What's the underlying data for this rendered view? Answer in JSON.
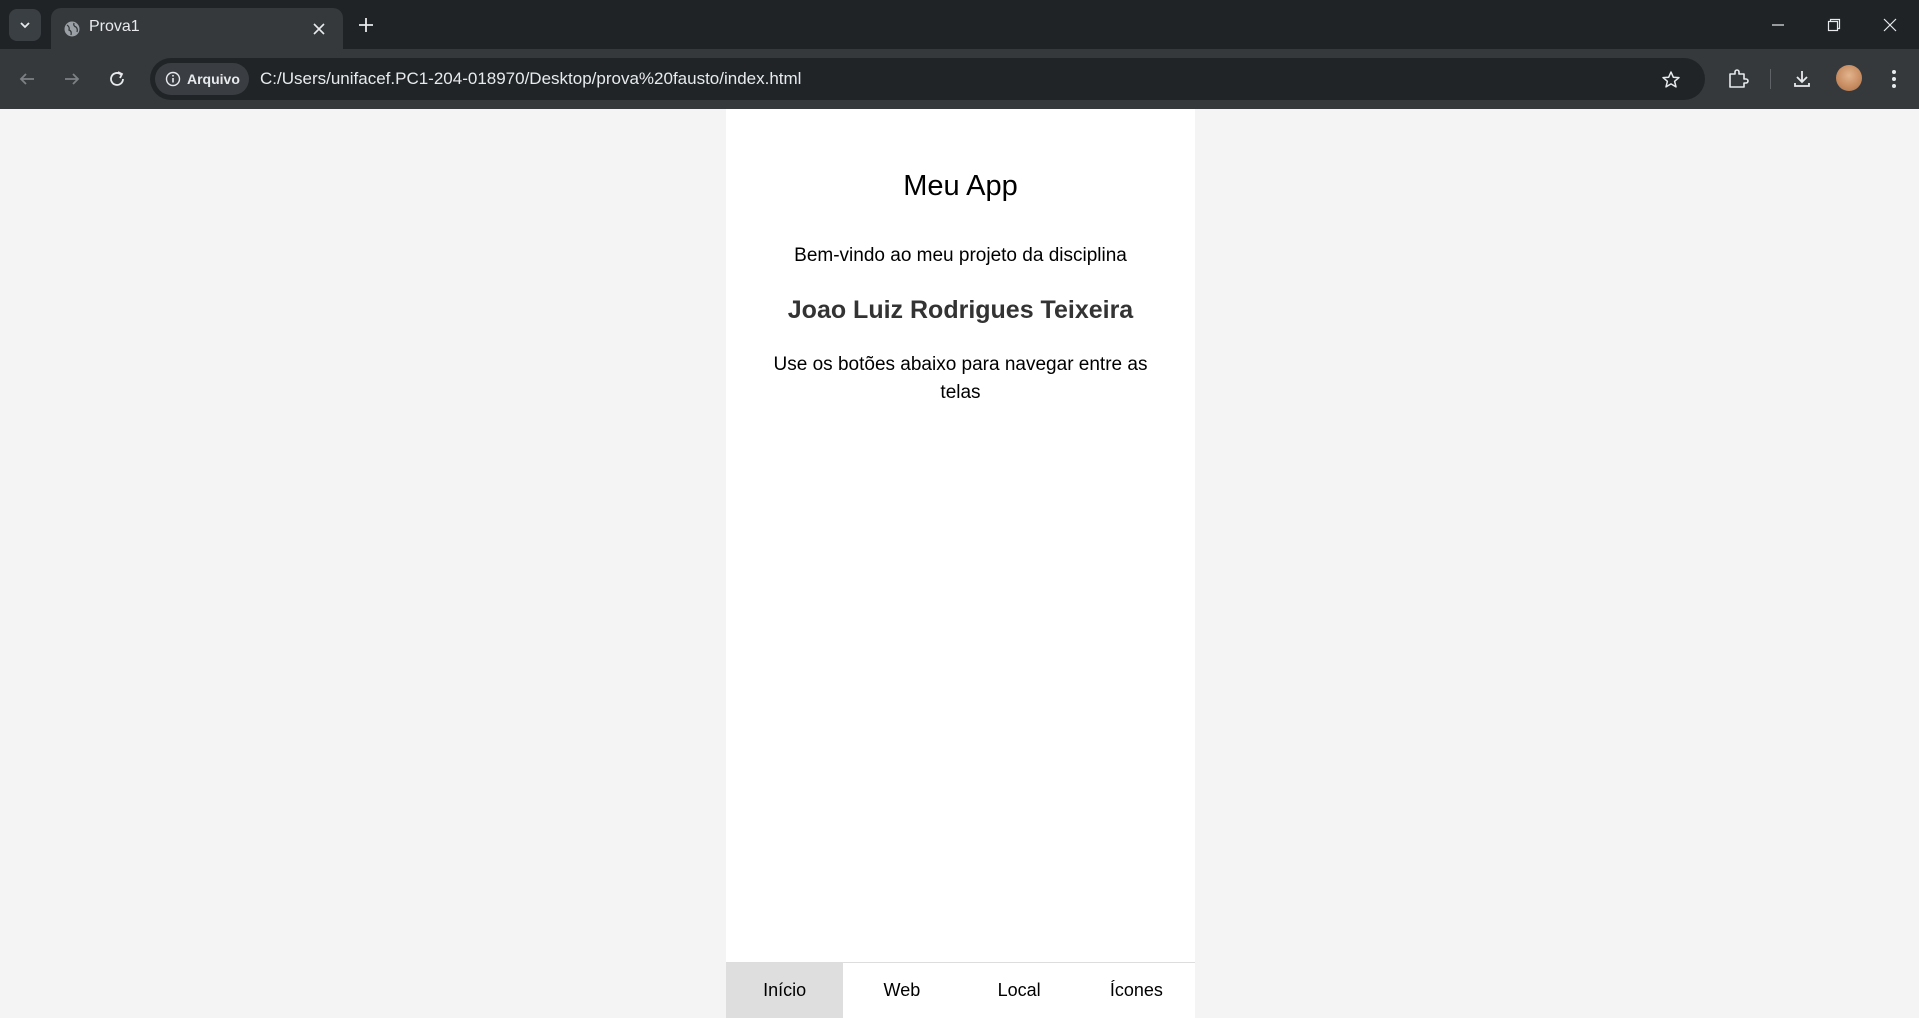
{
  "browser": {
    "tab_title": "Prova1",
    "security_chip": "Arquivo",
    "url": "C:/Users/unifacef.PC1-204-018970/Desktop/prova%20fausto/index.html"
  },
  "app": {
    "title": "Meu App",
    "welcome": "Bem-vindo ao meu projeto da disciplina",
    "student_name": "Joao Luiz Rodrigues Teixeira",
    "hint": "Use os botões abaixo para navegar entre as telas"
  },
  "bottom_nav": {
    "items": [
      {
        "label": "Início"
      },
      {
        "label": "Web"
      },
      {
        "label": "Local"
      },
      {
        "label": "Ícones"
      }
    ],
    "active_index": 0
  }
}
